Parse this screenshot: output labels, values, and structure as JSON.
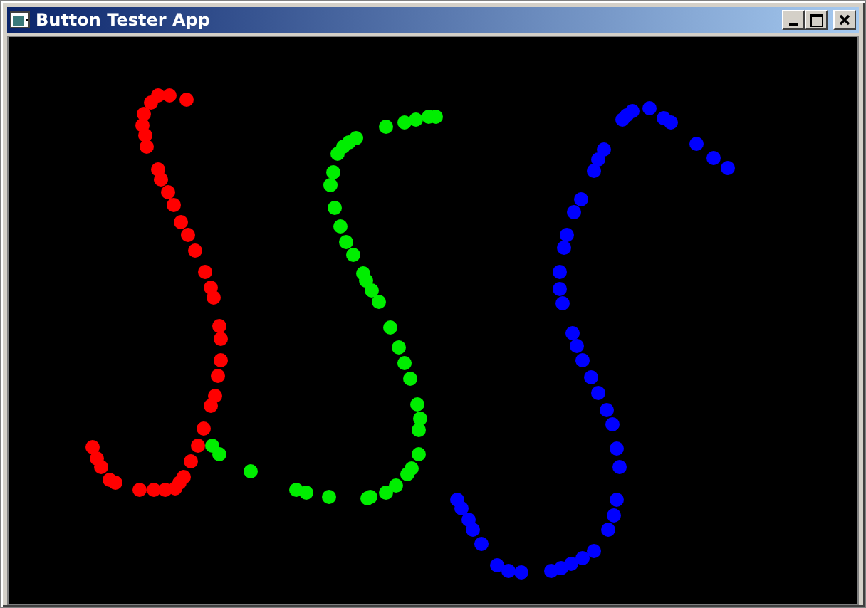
{
  "window": {
    "title": "Button Tester App"
  },
  "canvas": {
    "strokes": [
      {
        "color": "#ff0000"
      },
      {
        "color": "#00ee00"
      },
      {
        "color": "#0000ff"
      }
    ]
  }
}
